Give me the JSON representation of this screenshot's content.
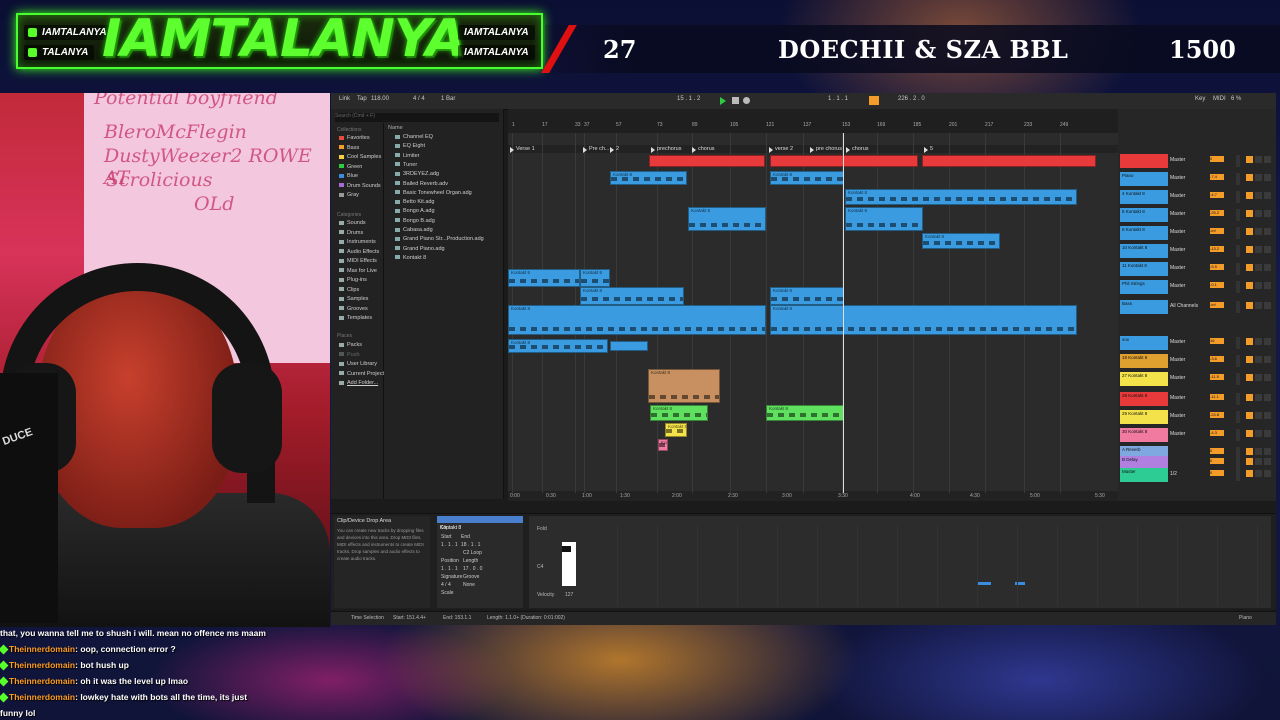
{
  "stream": {
    "brand_big": "IAMTALANYA",
    "handles_left": [
      "IAMTALANYA",
      "TALANYA"
    ],
    "handles_right": [
      "IAMTALANYA",
      "IAMTALANYA"
    ],
    "count": "27",
    "title": "DOECHII & SZA BBL",
    "goal": "1500",
    "accent": "#47ff2a"
  },
  "webcam": {
    "board_text": [
      "Potential boyfriend",
      "BleroMcFlegin",
      "DustyWeezer2 ROWE AT",
      "Scrolicious",
      "OLd"
    ],
    "headphones_label": "DUCE"
  },
  "daw": {
    "control_bar": [
      "Link",
      "Tap",
      "118.00",
      "4 / 4",
      "1 Bar",
      "15 . 1 . 2",
      "1 . 1 . 1",
      "226 . 2 . 0",
      "Key",
      "MIDI",
      "6 %"
    ],
    "browser": {
      "search_placeholder": "Search (Cmd + F)",
      "collections_label": "Collections",
      "collections": [
        {
          "name": "Favorites",
          "color": "#e94b3c"
        },
        {
          "name": "Bass",
          "color": "#f39c2a"
        },
        {
          "name": "Cool Samples",
          "color": "#f4d03f"
        },
        {
          "name": "Green",
          "color": "#2ecc40"
        },
        {
          "name": "Blue",
          "color": "#3a8dde"
        },
        {
          "name": "Drum Sounds",
          "color": "#a66bd6"
        },
        {
          "name": "Gray",
          "color": "#999999"
        }
      ],
      "categories_label": "Categories",
      "categories": [
        "Sounds",
        "Drums",
        "Instruments",
        "Audio Effects",
        "MIDI Effects",
        "Max for Live",
        "Plug-ins",
        "Clips",
        "Samples",
        "Grooves",
        "Templates"
      ],
      "places_label": "Places",
      "places": [
        "Packs",
        "Push",
        "User Library",
        "Current Project",
        "Add Folder..."
      ],
      "name_header": "Name",
      "files": [
        "Channel EQ",
        "EQ Eight",
        "Limiter",
        "Tuner",
        "3RDEYEZ.adg",
        "Bailed Reverb.adv",
        "Basic Tonewheel Organ.adg",
        "Betto Kit.adg",
        "Bongo A.adg",
        "Bongo B.adg",
        "Cabasa.adg",
        "Grand Piano Str...Production.adg",
        "Grand Piano.adg",
        "Kontakt 8"
      ]
    },
    "locators": [
      "Verse 1",
      "Pre ch...",
      "2",
      "prechorus",
      "chorus",
      "verse 2",
      "pre chorus",
      "chorus",
      "5"
    ],
    "ruler": [
      "1",
      "17",
      "33",
      "37",
      "57",
      "73",
      "89",
      "105",
      "121",
      "137",
      "153",
      "169",
      "185",
      "201",
      "217",
      "233",
      "249"
    ],
    "timeline": [
      "0:00",
      "0:30",
      "1:00",
      "1:30",
      "2:00",
      "2:30",
      "3:00",
      "3:30",
      "4:00",
      "4:30",
      "5:00",
      "5:30"
    ],
    "clip_names": [
      "Kontakt 8",
      "Kontakt 8",
      "Kontakt 8",
      "Kontakt 8",
      "Kontakt 8",
      "Kontakt 8",
      "Kontakt 8",
      "Kontakt 8",
      "Kontakt 8",
      "Kontakt 8",
      "Kontakt 8",
      "Kontakt 8",
      "Kontakt 8",
      "Kontakt 8",
      "Kontakt 8",
      "Kontakt 8",
      "Kontakt 8",
      "Kontakt 8",
      "Kontakt 8",
      "Kontakt 8",
      "Kontakt 8",
      "Kontakt 8",
      "Kontakt 8",
      "Kontakt 8",
      "Kontakt 8",
      "Kontakt 8",
      "Kontakt 8"
    ],
    "mixer": [
      {
        "name": "",
        "color": "#e83a3a",
        "out": "Master",
        "vol": "0"
      },
      {
        "name": "Piano",
        "color": "#3a9be0",
        "out": "Master",
        "vol": "-7.4"
      },
      {
        "name": "4 Kontakt 8",
        "color": "#3a9be0",
        "out": "Master",
        "vol": "-4.7"
      },
      {
        "name": "5 Kontakt 8",
        "color": "#3a9be0",
        "out": "Master",
        "vol": "-25.2"
      },
      {
        "name": "6 Kontakt 8",
        "color": "#3a9be0",
        "out": "Master",
        "vol": "-inf"
      },
      {
        "name": "10 Kontakt 8",
        "color": "#3a9be0",
        "out": "Master",
        "vol": "-13.2"
      },
      {
        "name": "11 Kontakt 8",
        "color": "#3a9be0",
        "out": "Master",
        "vol": "-5.5"
      },
      {
        "name": "Phil Strings",
        "color": "#3a9be0",
        "out": "Master",
        "vol": "-0.1"
      },
      {
        "name": "Bass",
        "color": "#3a9be0",
        "out": "All Channels",
        "vol": "-inf"
      },
      {
        "name": "vox",
        "color": "#3a9be0",
        "out": "Master",
        "vol": "16"
      },
      {
        "name": "18 Kontakt 8",
        "color": "#e0a030",
        "out": "Master",
        "vol": "-3.6"
      },
      {
        "name": "27 Kontakt 8",
        "color": "#f4e24a",
        "out": "Master",
        "vol": "-11.5"
      },
      {
        "name": "28 Kontakt 8",
        "color": "#e83a3a",
        "out": "Master",
        "vol": "-11.1"
      },
      {
        "name": "29 Kontakt 8",
        "color": "#f4e24a",
        "out": "Master",
        "vol": "-24.8"
      },
      {
        "name": "30 Kontakt 8",
        "color": "#f07aa0",
        "out": "Master",
        "vol": "-4.3"
      },
      {
        "name": "A Reverb",
        "color": "#7fa7e0",
        "out": "",
        "vol": "0"
      },
      {
        "name": "B Delay",
        "color": "#b07fe0",
        "out": "",
        "vol": "0"
      },
      {
        "name": "Master",
        "color": "#2ecc95",
        "out": "1/2",
        "vol": "0"
      }
    ],
    "device_drop": {
      "title": "Clip/Device Drop Area",
      "text": "You can create new tracks by dropping files and devices into this area. Drop MIDI files, MIDI effects and instruments to create MIDI tracks. Drop samples and audio effects to create audio tracks."
    },
    "clip_props": {
      "name": "Kontakt 8",
      "tab": "Clip",
      "fields": [
        "Start",
        "End",
        "1 . 1 . 1",
        "18 . 1 . 1",
        "C2 Loop",
        "Position",
        "Length",
        "1 . 1 . 1",
        "17 . 0 . 0",
        "Signature",
        "Groove",
        "4 / 4",
        "None",
        "Scale"
      ]
    },
    "piano_roll": {
      "fold": "Fold",
      "note_label": "C4",
      "velocity": "Velocity",
      "vel_value": "127"
    },
    "status_bar": [
      "Time Selection",
      "Start: 151.4.4+",
      "End: 153.1.1",
      "Length: 1.1.0+ (Duration: 0:01:002)",
      "Piano"
    ]
  },
  "chat": [
    {
      "user": "",
      "msg": "that, you wanna tell me to shush i will. mean no offence ms maam"
    },
    {
      "user": "Theinnerdomain",
      "msg": ": oop, connection error ?"
    },
    {
      "user": "Theinnerdomain",
      "msg": ": bot hush up"
    },
    {
      "user": "Theinnerdomain",
      "msg": ": oh it was the level up lmao"
    },
    {
      "user": "Theinnerdomain",
      "msg": ": lowkey hate with bots all the time, its just"
    },
    {
      "user": "",
      "msg": "funny lol"
    }
  ]
}
